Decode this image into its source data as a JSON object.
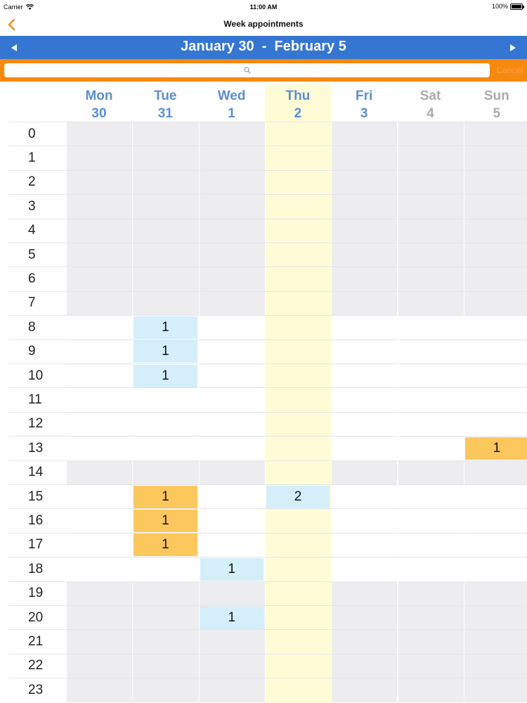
{
  "status_bar": {
    "carrier": "Carrier",
    "time": "11:00 AM",
    "battery": "100%"
  },
  "nav": {
    "title": "Week appointments",
    "back_icon": "chevron-left-icon"
  },
  "week": {
    "range": "January 30  -  February 5",
    "prev_icon": "triangle-left-icon",
    "next_icon": "triangle-right-icon"
  },
  "search": {
    "placeholder": "",
    "value": "",
    "cancel_label": "Cancel"
  },
  "days": [
    {
      "name": "Mon",
      "num": "30",
      "weekend": false
    },
    {
      "name": "Tue",
      "num": "31",
      "weekend": false
    },
    {
      "name": "Wed",
      "num": "1",
      "weekend": false
    },
    {
      "name": "Thu",
      "num": "2",
      "weekend": false,
      "today": true
    },
    {
      "name": "Fri",
      "num": "3",
      "weekend": false
    },
    {
      "name": "Sat",
      "num": "4",
      "weekend": true
    },
    {
      "name": "Sun",
      "num": "5",
      "weekend": true
    }
  ],
  "hours": [
    "0",
    "1",
    "2",
    "3",
    "4",
    "5",
    "6",
    "7",
    "8",
    "9",
    "10",
    "11",
    "12",
    "13",
    "14",
    "15",
    "16",
    "17",
    "18",
    "19",
    "20",
    "21",
    "22",
    "23"
  ],
  "open_hours": [
    8,
    9,
    10,
    11,
    12,
    13,
    15,
    16,
    17,
    18
  ],
  "appointments": [
    {
      "day": 1,
      "hour": 8,
      "count": "1",
      "color": "blue"
    },
    {
      "day": 1,
      "hour": 9,
      "count": "1",
      "color": "blue"
    },
    {
      "day": 1,
      "hour": 10,
      "count": "1",
      "color": "blue"
    },
    {
      "day": 6,
      "hour": 13,
      "count": "1",
      "color": "orange"
    },
    {
      "day": 1,
      "hour": 15,
      "count": "1",
      "color": "orange"
    },
    {
      "day": 3,
      "hour": 15,
      "count": "2",
      "color": "blue"
    },
    {
      "day": 1,
      "hour": 16,
      "count": "1",
      "color": "orange"
    },
    {
      "day": 1,
      "hour": 17,
      "count": "1",
      "color": "orange"
    },
    {
      "day": 2,
      "hour": 18,
      "count": "1",
      "color": "blue"
    },
    {
      "day": 2,
      "hour": 20,
      "count": "1",
      "color": "blue"
    }
  ],
  "colors": {
    "header_blue": "#3476d1",
    "search_orange": "#f7890f",
    "today_yellow": "#fefcd6",
    "appt_blue": "#d4eefa",
    "appt_orange": "#fcc75c",
    "closed_gray": "#ededf0"
  }
}
